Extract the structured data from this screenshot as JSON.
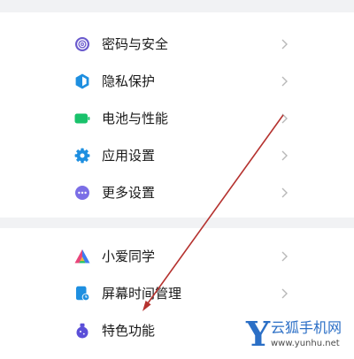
{
  "colors": {
    "background": "#f1f2f4",
    "card": "#ffffff",
    "text": "#1a1a1a",
    "chevron": "#b8b8b8",
    "annotation": "#b5322f",
    "watermark": "#2b6fc6"
  },
  "settings": {
    "group1": [
      {
        "label": "密码与安全",
        "icon": "fingerprint-icon",
        "icon_color": "#6a5acd"
      },
      {
        "label": "隐私保护",
        "icon": "privacy-shield-icon",
        "icon_color": "#1e8fe0"
      },
      {
        "label": "电池与性能",
        "icon": "battery-icon",
        "icon_color": "#19c26b"
      },
      {
        "label": "应用设置",
        "icon": "app-settings-gear-icon",
        "icon_color": "#1e8fe0"
      },
      {
        "label": "更多设置",
        "icon": "more-settings-dots-icon",
        "icon_color": "#7b6ee6"
      }
    ],
    "group2": [
      {
        "label": "小爱同学",
        "icon": "xiaoai-assistant-icon",
        "icon_color": "#3d7cf0"
      },
      {
        "label": "屏幕时间管理",
        "icon": "screen-time-icon",
        "icon_color": "#1e8fe0"
      },
      {
        "label": "特色功能",
        "icon": "special-features-flask-icon",
        "icon_color": "#5b4fd8"
      }
    ]
  },
  "watermark": {
    "letter": "Y",
    "name": "云狐手机网",
    "url": "www.yunhu.net"
  }
}
